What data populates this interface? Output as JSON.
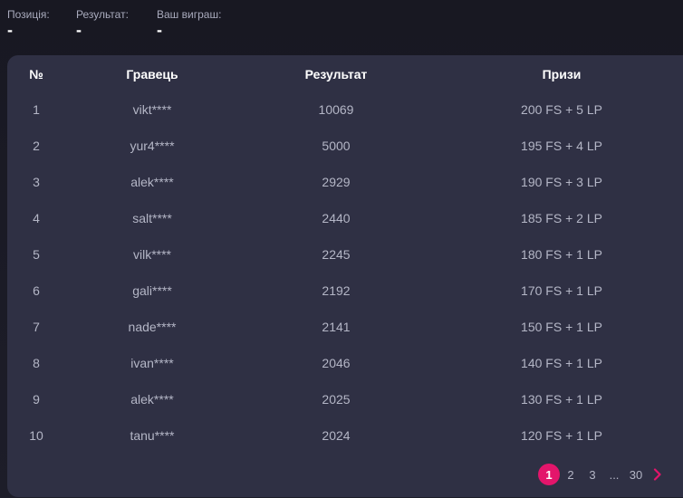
{
  "summary": {
    "position_label": "Позиція:",
    "position_value": "-",
    "result_label": "Результат:",
    "result_value": "-",
    "winnings_label": "Ваш виграш:",
    "winnings_value": "-"
  },
  "table": {
    "headers": {
      "rank": "№",
      "player": "Гравець",
      "result": "Результат",
      "prizes": "Призи"
    },
    "rows": [
      {
        "rank": "1",
        "player": "vikt****",
        "result": "10069",
        "prize": "200 FS + 5 LP"
      },
      {
        "rank": "2",
        "player": "yur4****",
        "result": "5000",
        "prize": "195 FS + 4 LP"
      },
      {
        "rank": "3",
        "player": "alek****",
        "result": "2929",
        "prize": "190 FS + 3 LP"
      },
      {
        "rank": "4",
        "player": "salt****",
        "result": "2440",
        "prize": "185 FS + 2 LP"
      },
      {
        "rank": "5",
        "player": "vilk****",
        "result": "2245",
        "prize": "180 FS + 1 LP"
      },
      {
        "rank": "6",
        "player": "gali****",
        "result": "2192",
        "prize": "170 FS + 1 LP"
      },
      {
        "rank": "7",
        "player": "nade****",
        "result": "2141",
        "prize": "150 FS + 1 LP"
      },
      {
        "rank": "8",
        "player": "ivan****",
        "result": "2046",
        "prize": "140 FS + 1 LP"
      },
      {
        "rank": "9",
        "player": "alek****",
        "result": "2025",
        "prize": "130 FS + 1 LP"
      },
      {
        "rank": "10",
        "player": "tanu****",
        "result": "2024",
        "prize": "120 FS + 1 LP"
      }
    ]
  },
  "pagination": {
    "current": "1",
    "pages": [
      "1",
      "2",
      "3"
    ],
    "ellipsis": "...",
    "last": "30",
    "next_icon": "chevron-right-icon",
    "accent_color": "#e3156b"
  },
  "colors": {
    "background": "#1c1c27",
    "panel": "#2f3044",
    "accent": "#e3156b",
    "text_primary": "#ffffff",
    "text_secondary": "#b4b6c6"
  }
}
